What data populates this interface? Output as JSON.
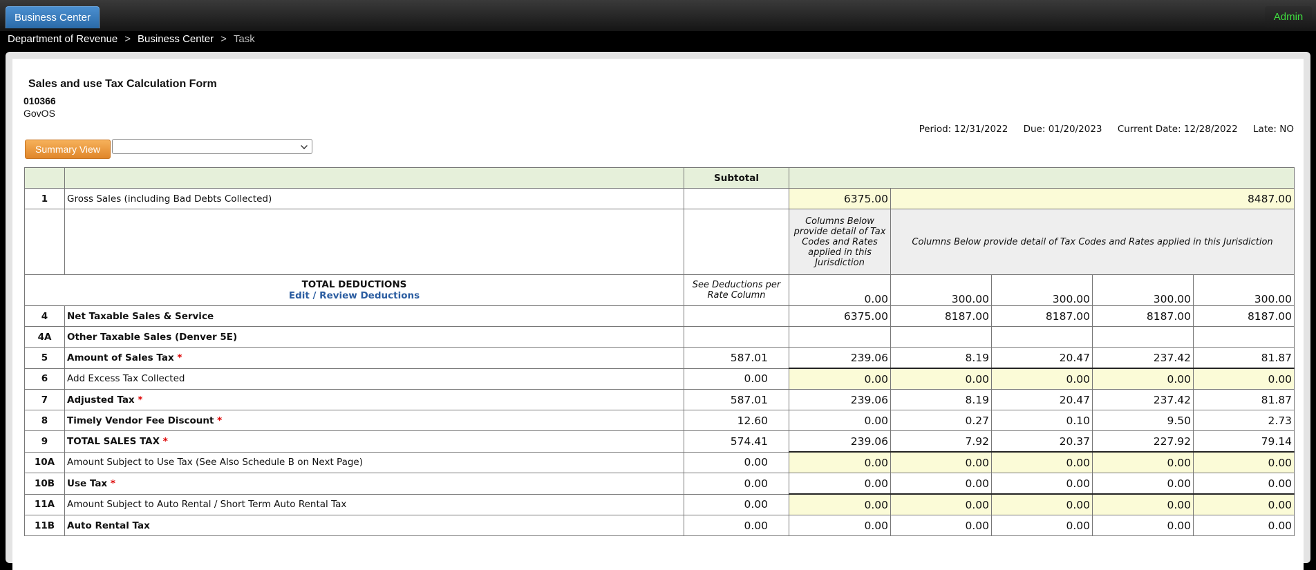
{
  "nav": {
    "tab_label": "Business Center",
    "user_label": "Admin"
  },
  "breadcrumb": {
    "items": [
      "Department of Revenue",
      "Business Center"
    ],
    "current": "Task",
    "sep": ">"
  },
  "form": {
    "title": "Sales and use Tax Calculation Form",
    "id": "010366",
    "org": "GovOS",
    "period": "Period: 12/31/2022",
    "due": "Due: 01/20/2023",
    "current_date": "Current Date: 12/28/2022",
    "late": "Late: NO",
    "summary_button": "Summary View",
    "view_select_value": ""
  },
  "table": {
    "subtotal_header": "Subtotal",
    "gross": {
      "num": "1",
      "label": "Gross Sales (including Bad Debts Collected)",
      "col1": "6375.00",
      "col2": "8487.00"
    },
    "columns_note_narrow": "Columns Below provide detail of Tax Codes and Rates applied in this Jurisdiction",
    "columns_note_wide": "Columns Below provide detail of Tax Codes and Rates applied in this Jurisdiction",
    "deductions": {
      "label": "TOTAL DEDUCTIONS",
      "link": "Edit / Review Deductions",
      "subtotal_note": "See Deductions per Rate Column",
      "values": [
        "0.00",
        "300.00",
        "300.00",
        "300.00",
        "300.00"
      ]
    },
    "rows": [
      {
        "num": "4",
        "label": "Net Taxable Sales & Service",
        "bold": true,
        "req": false,
        "subtotal": "",
        "values": [
          "6375.00",
          "8187.00",
          "8187.00",
          "8187.00",
          "8187.00"
        ],
        "input": false
      },
      {
        "num": "4A",
        "label": "Other Taxable Sales (Denver 5E)",
        "bold": true,
        "req": false,
        "subtotal": "",
        "values": [
          "",
          "",
          "",
          "",
          ""
        ],
        "input": false
      },
      {
        "num": "5",
        "label": "Amount of Sales Tax",
        "bold": true,
        "req": true,
        "subtotal": "587.01",
        "values": [
          "239.06",
          "8.19",
          "20.47",
          "237.42",
          "81.87"
        ],
        "input": false
      },
      {
        "num": "6",
        "label": "Add Excess Tax Collected",
        "bold": false,
        "req": false,
        "subtotal": "0.00",
        "values": [
          "0.00",
          "0.00",
          "0.00",
          "0.00",
          "0.00"
        ],
        "input": true
      },
      {
        "num": "7",
        "label": "Adjusted Tax",
        "bold": true,
        "req": true,
        "subtotal": "587.01",
        "values": [
          "239.06",
          "8.19",
          "20.47",
          "237.42",
          "81.87"
        ],
        "input": false
      },
      {
        "num": "8",
        "label": "Timely Vendor Fee Discount",
        "bold": true,
        "req": true,
        "subtotal": "12.60",
        "values": [
          "0.00",
          "0.27",
          "0.10",
          "9.50",
          "2.73"
        ],
        "input": false
      },
      {
        "num": "9",
        "label": "TOTAL SALES TAX",
        "bold": true,
        "req": true,
        "subtotal": "574.41",
        "values": [
          "239.06",
          "7.92",
          "20.37",
          "227.92",
          "79.14"
        ],
        "input": false
      },
      {
        "num": "10A",
        "label": "Amount Subject to Use Tax (See Also Schedule B on Next Page)",
        "bold": false,
        "req": false,
        "subtotal": "0.00",
        "values": [
          "0.00",
          "0.00",
          "0.00",
          "0.00",
          "0.00"
        ],
        "input": true
      },
      {
        "num": "10B",
        "label": "Use Tax",
        "bold": true,
        "req": true,
        "subtotal": "0.00",
        "values": [
          "0.00",
          "0.00",
          "0.00",
          "0.00",
          "0.00"
        ],
        "input": false
      },
      {
        "num": "11A",
        "label": "Amount Subject to Auto Rental / Short Term Auto Rental Tax",
        "bold": false,
        "req": false,
        "subtotal": "0.00",
        "values": [
          "0.00",
          "0.00",
          "0.00",
          "0.00",
          "0.00"
        ],
        "input": true
      },
      {
        "num": "11B",
        "label": "Auto Rental Tax",
        "bold": true,
        "req": false,
        "subtotal": "0.00",
        "values": [
          "0.00",
          "0.00",
          "0.00",
          "0.00",
          "0.00"
        ],
        "input": false
      }
    ]
  }
}
